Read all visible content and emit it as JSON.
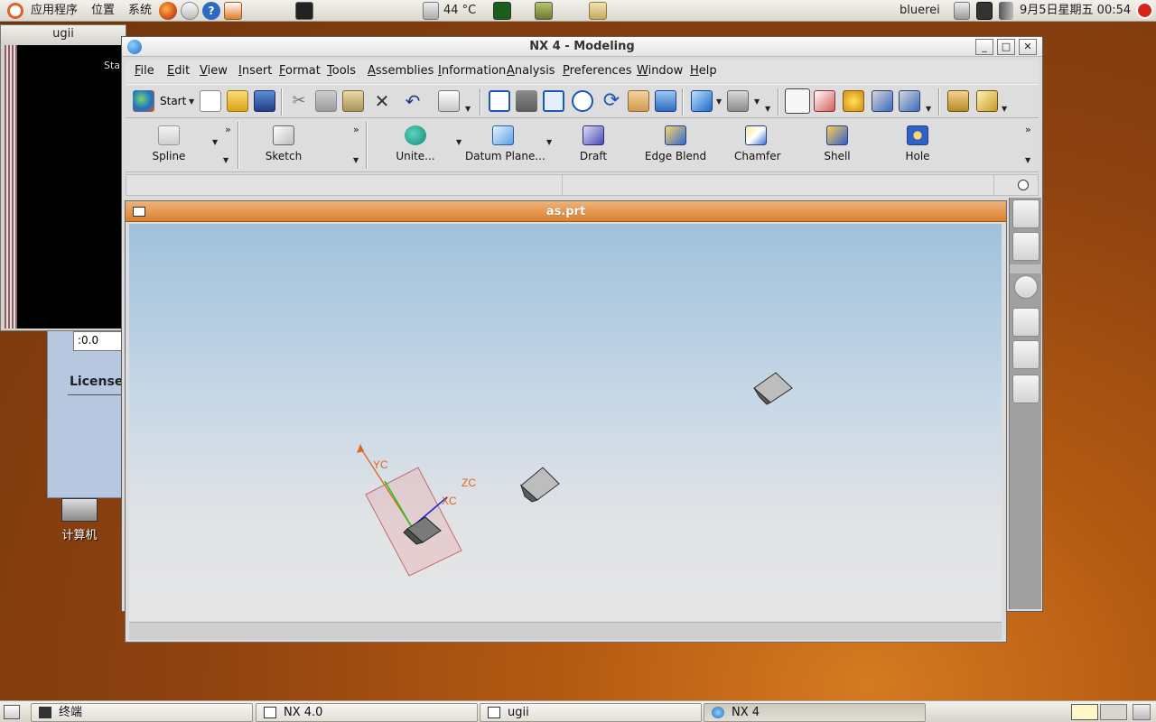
{
  "top_panel": {
    "menus": [
      "应用程序",
      "位置",
      "系统"
    ],
    "temperature": "44 °C",
    "user": "bluerei",
    "datetime": "9月5日星期五  00:54"
  },
  "desktop": {
    "computer_icon_label": "计算机"
  },
  "ugii_window": {
    "title": "ugii",
    "terminal_text": "Sta"
  },
  "nx40_window": {
    "field_value": ":0.0",
    "license_label": "License"
  },
  "main_window": {
    "title": "NX 4 - Modeling",
    "menu": [
      "File",
      "Edit",
      "View",
      "Insert",
      "Format",
      "Tools",
      "Assemblies",
      "Information",
      "Analysis",
      "Preferences",
      "Window",
      "Help"
    ],
    "start_label": "Start",
    "features": [
      "Spline",
      "Sketch",
      "Unite...",
      "Datum Plane...",
      "Draft",
      "Edge Blend",
      "Chamfer",
      "Shell",
      "Hole"
    ]
  },
  "graphics_window": {
    "title": "as.prt",
    "axis_labels": {
      "yc": "YC",
      "zc": "ZC",
      "xc": "XC"
    }
  },
  "taskbar": {
    "tasks": [
      "终端",
      "NX 4.0",
      "ugii",
      "NX 4"
    ]
  },
  "colors": {
    "title_orange": "#d9802e",
    "viewport_top": "#9fc1dc",
    "viewport_bottom": "#e6e6e6",
    "axis_orange": "#e0641a",
    "ycaxis_green": "#22c322",
    "zcaxis_blue": "#2222e0"
  }
}
